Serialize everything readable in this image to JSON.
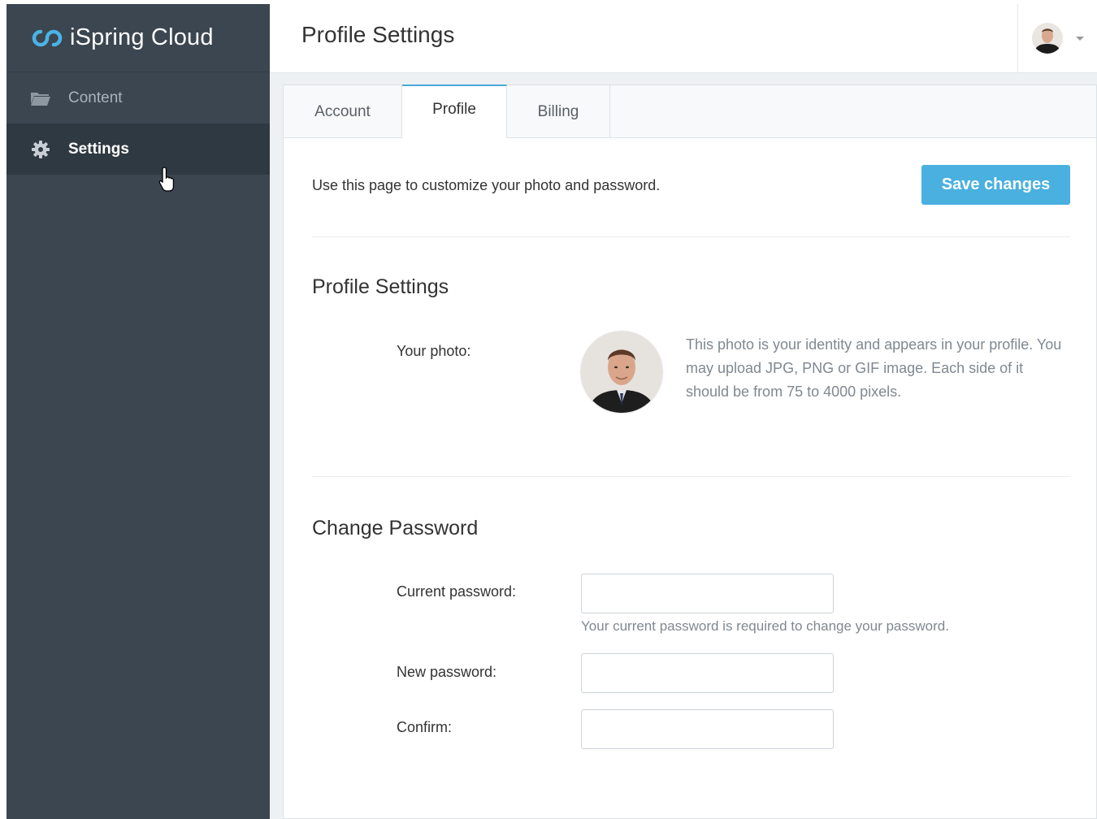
{
  "app": {
    "brand": "iSpring Cloud"
  },
  "sidebar": {
    "items": [
      {
        "label": "Content",
        "icon": "folder-icon"
      },
      {
        "label": "Settings",
        "icon": "gear-icon"
      }
    ]
  },
  "header": {
    "title": "Profile Settings",
    "user_avatar": "user-avatar"
  },
  "tabs": [
    {
      "label": "Account"
    },
    {
      "label": "Profile"
    },
    {
      "label": "Billing"
    }
  ],
  "main": {
    "intro": "Use this page to customize your photo and password.",
    "save_label": "Save changes",
    "profile_section": {
      "title": "Profile Settings",
      "photo_label": "Your photo:",
      "photo_help": "This photo is your identity and appears in your profile. You may upload JPG, PNG or GIF image. Each side of it should be from 75 to 4000 pixels."
    },
    "password_section": {
      "title": "Change Password",
      "current_label": "Current password:",
      "current_help": "Your current password is required to change your password.",
      "new_label": "New password:",
      "confirm_label": "Confirm:",
      "current_value": "",
      "new_value": "",
      "confirm_value": ""
    }
  },
  "colors": {
    "sidebar": "#3b4650",
    "accent": "#49b0e0"
  }
}
